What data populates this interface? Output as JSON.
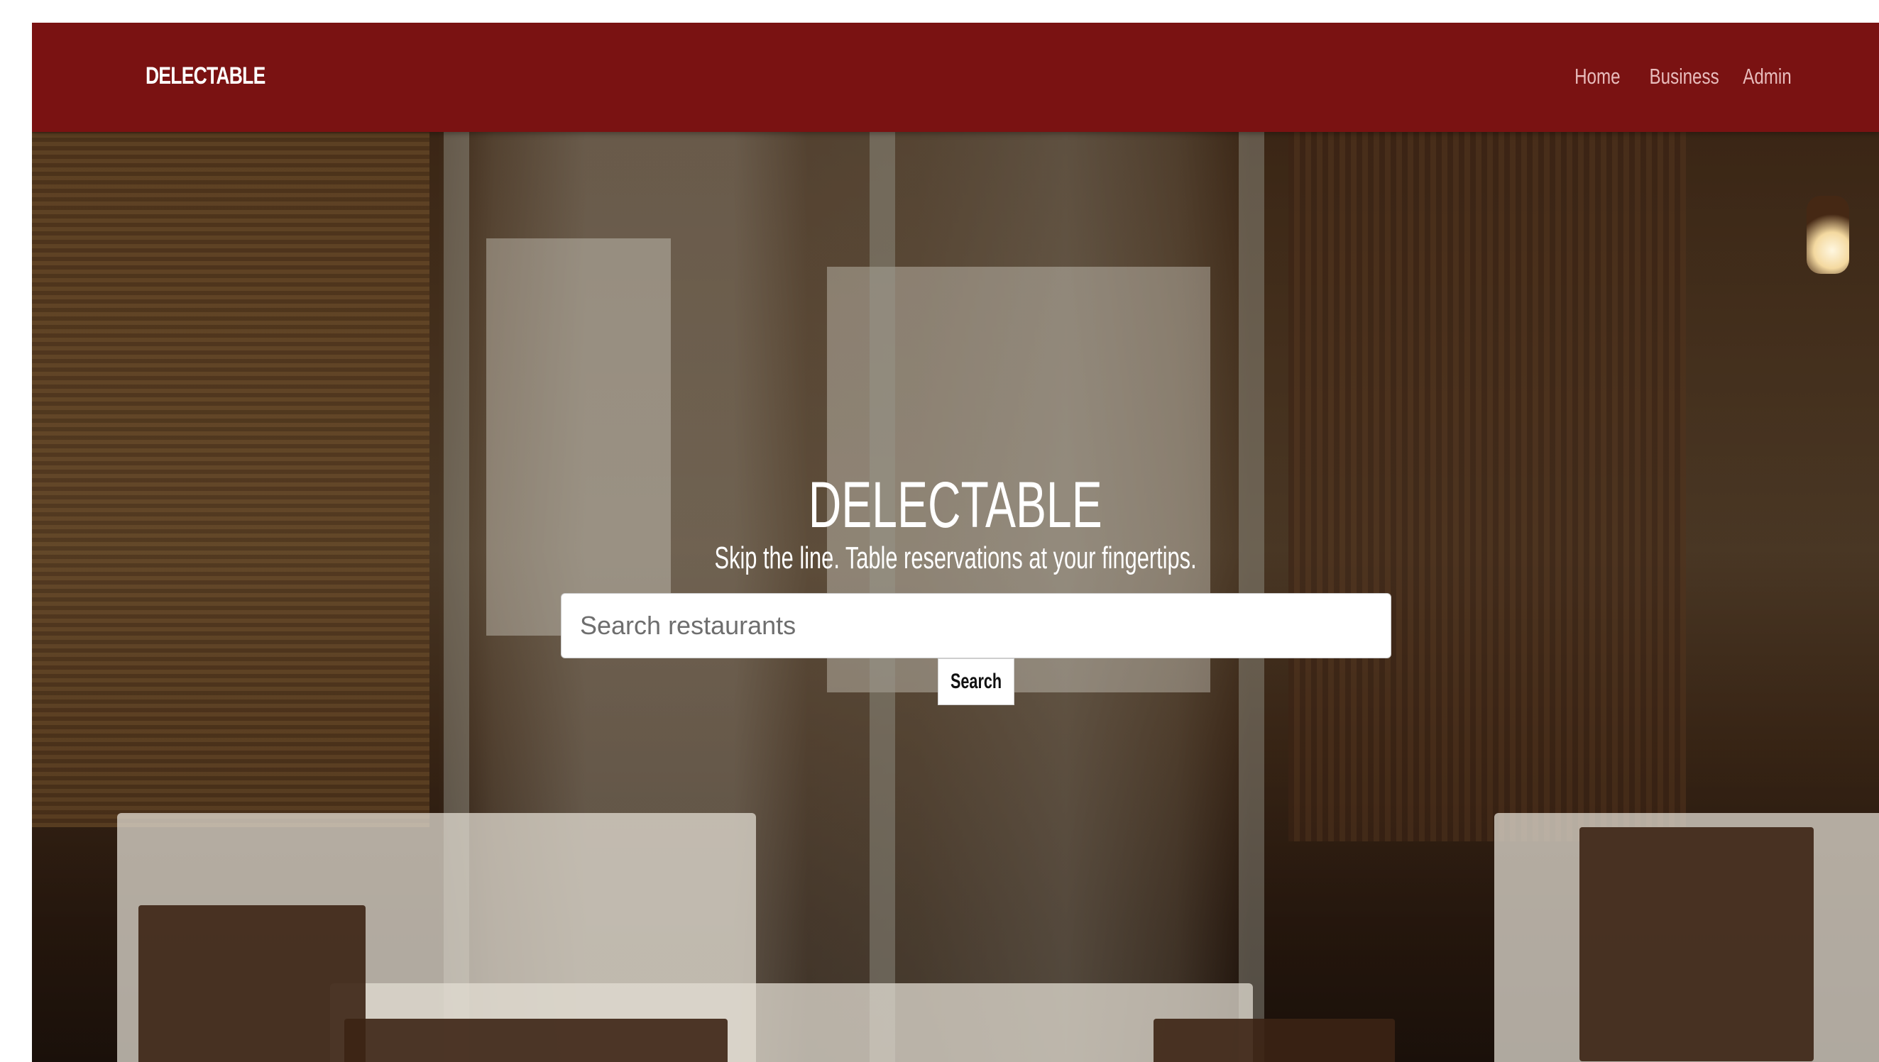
{
  "navbar": {
    "brand": "DELECTABLE",
    "links": [
      {
        "label": "Home"
      },
      {
        "label": "Business"
      },
      {
        "label": "Admin"
      }
    ],
    "background_color": "#7a1212"
  },
  "hero": {
    "title": "DELECTABLE",
    "subtitle": "Skip the line. Table reservations at your fingertips.",
    "search": {
      "placeholder": "Search restaurants",
      "value": "",
      "button_label": "Search"
    },
    "background_image": "restaurant-interior-photo"
  }
}
